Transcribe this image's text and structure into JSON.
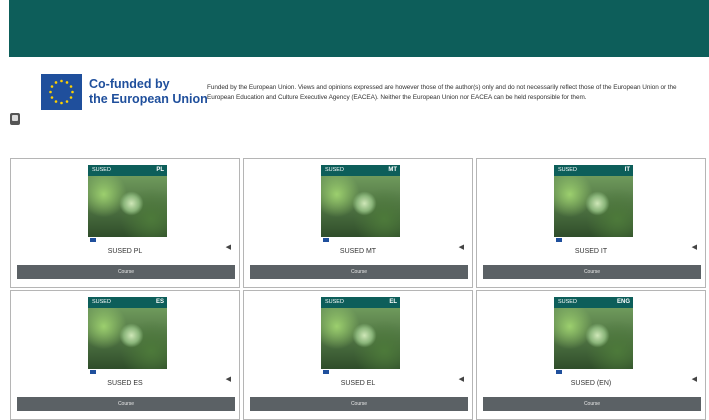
{
  "header": {
    "cofunded_line1": "Co-funded by",
    "cofunded_line2": "the European Union",
    "disclaimer": "Funded by the European Union. Views and opinions expressed are however those of the author(s) only and do not necessarily reflect those of the European Union or the European Education and Culture Executive Agency (EACEA). Neither the European Union nor EACEA can be held responsible for them.",
    "colors": {
      "top_bar": "#0d5e5a",
      "eu_blue": "#1f4f9c",
      "eu_star": "#ffd200"
    }
  },
  "cover_brand": "SUSED",
  "courses": [
    {
      "title": "SUSED PL",
      "code": "PL",
      "button_label": "Course"
    },
    {
      "title": "SUSED MT",
      "code": "MT",
      "button_label": "Course"
    },
    {
      "title": "SUSED IT",
      "code": "IT",
      "button_label": "Course"
    },
    {
      "title": "SUSED ES",
      "code": "ES",
      "button_label": "Course"
    },
    {
      "title": "SUSED EL",
      "code": "EL",
      "button_label": "Course"
    },
    {
      "title": "SUSED (EN)",
      "code": "ENG",
      "button_label": "Course"
    }
  ],
  "icons": {
    "side": "sidebar-toggle-icon",
    "speaker": "speaker-icon"
  }
}
